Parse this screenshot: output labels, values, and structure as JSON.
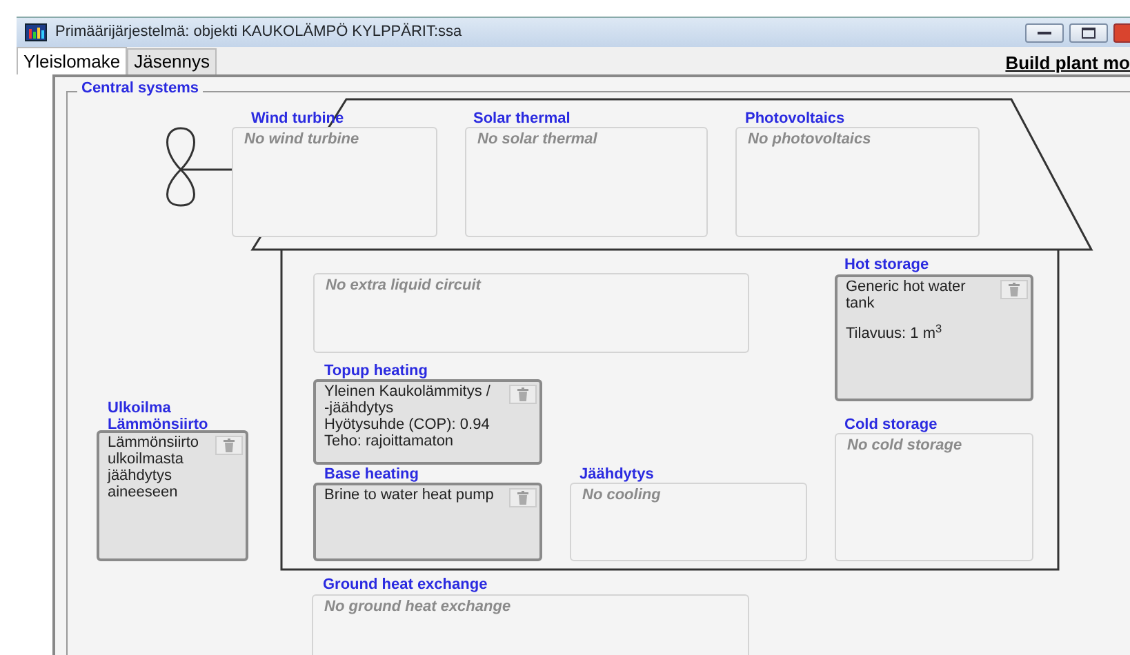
{
  "window": {
    "title": "Primäärijärjestelmä: objekti KAUKOLÄMPÖ KYLPPÄRIT:ssa"
  },
  "tabs": [
    {
      "label": "Yleislomake",
      "selected": true
    },
    {
      "label": "Jäsennys",
      "selected": false
    }
  ],
  "build_link": "Build plant mo",
  "group_title": "Central systems",
  "slots": [
    {
      "label": "Wind turbine",
      "kind": "empty",
      "lines": [
        "No wind turbine"
      ]
    },
    {
      "label": "Solar thermal",
      "kind": "empty",
      "lines": [
        "No solar thermal"
      ]
    },
    {
      "label": "Photovoltaics",
      "kind": "empty",
      "lines": [
        "No photovoltaics"
      ]
    },
    {
      "kind": "empty",
      "lines": [
        "No extra liquid circuit"
      ]
    },
    {
      "label": "Hot storage",
      "kind": "filled",
      "lines": [
        "Generic hot water tank",
        "Tilavuus: 1 m$^{3}$"
      ]
    },
    {
      "label": "Topup heating",
      "kind": "filled",
      "lines": [
        "Yleinen Kaukolämmitys / -jäähdytys",
        "Hyötysuhde (COP): 0.94",
        "Teho: rajoittamaton"
      ]
    },
    {
      "label": "Ulkoilma Lämmönsiirto",
      "kind": "filled",
      "lines": [
        "Lämmönsiirto ulkoilmasta jäähdytys aineeseen"
      ]
    },
    {
      "label": "Cold storage",
      "kind": "empty",
      "lines": [
        "No cold storage"
      ]
    },
    {
      "label": "Base heating",
      "kind": "filled",
      "lines": [
        "Brine to water heat pump"
      ]
    },
    {
      "label": "Jäähdytys",
      "kind": "empty",
      "lines": [
        "No cooling"
      ]
    },
    {
      "label": "Ground heat exchange",
      "kind": "empty",
      "lines": [
        "No ground heat exchange"
      ]
    }
  ]
}
